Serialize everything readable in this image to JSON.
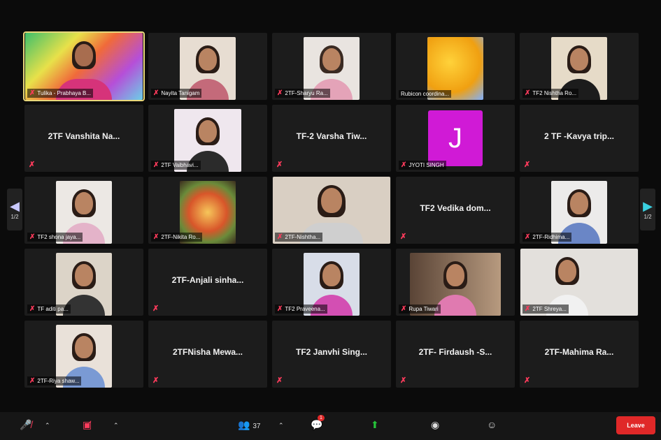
{
  "tiles": [
    {
      "name": "Tulika - Prabhaya B...",
      "type": "video",
      "active": true
    },
    {
      "name": "Nayita Tanigam",
      "type": "video"
    },
    {
      "name": "2TF-Sharyu Ra...",
      "type": "video"
    },
    {
      "name": "Rubicon coordina...",
      "type": "video"
    },
    {
      "name": "TF2 Nishtha Ro...",
      "type": "video"
    },
    {
      "name": "2TF Vanshita Na...",
      "type": "name"
    },
    {
      "name": "2TF Vaibhavi...",
      "type": "video"
    },
    {
      "name": "TF-2 Varsha Tiw...",
      "type": "name"
    },
    {
      "name": "JYOTI SINGH",
      "type": "avatar",
      "initial": "J"
    },
    {
      "name": "2 TF -Kavya trip...",
      "type": "name"
    },
    {
      "name": "TF2 shona jaya...",
      "type": "video"
    },
    {
      "name": "2TF-Nikita Ro...",
      "type": "video"
    },
    {
      "name": "2TF-Nishtha...",
      "type": "video"
    },
    {
      "name": "TF2 Vedika dom...",
      "type": "name"
    },
    {
      "name": "2TF-Ridhima...",
      "type": "video"
    },
    {
      "name": "TF aditi pa...",
      "type": "video"
    },
    {
      "name": "2TF-Anjali sinha...",
      "type": "name"
    },
    {
      "name": "TF2 Praveena...",
      "type": "video"
    },
    {
      "name": "Rupa Tiwari",
      "type": "video"
    },
    {
      "name": "2TF Shreya...",
      "type": "video"
    },
    {
      "name": "2TF-Riya shaw...",
      "type": "video"
    },
    {
      "name": "2TFNisha Mewa...",
      "type": "name"
    },
    {
      "name": "TF2 Janvhi Sing...",
      "type": "name"
    },
    {
      "name": "2TF- Firdaush -S...",
      "type": "name"
    },
    {
      "name": "2TF-Mahima Ra...",
      "type": "name"
    }
  ],
  "pagination": {
    "left_label": "1/2",
    "right_label": "1/2"
  },
  "toolbar": {
    "participants_count": "37",
    "chat_badge": "1",
    "end_label": "Leave"
  }
}
